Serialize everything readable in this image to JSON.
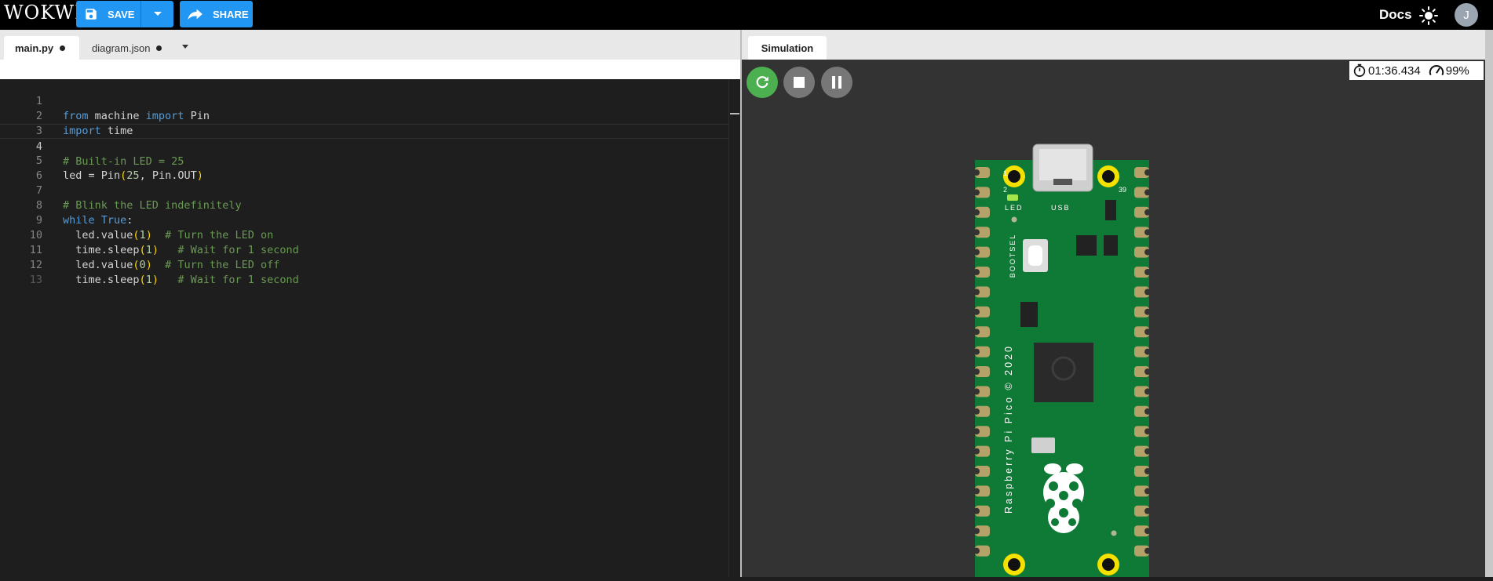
{
  "app": {
    "logo": "WOKWI"
  },
  "header": {
    "save_label": "SAVE",
    "share_label": "SHARE",
    "docs_label": "Docs",
    "avatar_initial": "J"
  },
  "editor": {
    "tabs": [
      {
        "label": "main.py",
        "modified": true
      },
      {
        "label": "diagram.json",
        "modified": true
      }
    ],
    "lines": [
      {
        "n": "1",
        "text": "from machine import Pin"
      },
      {
        "n": "2",
        "text": "import time"
      },
      {
        "n": "3",
        "text": ""
      },
      {
        "n": "4",
        "text": "# Built-in LED = 25"
      },
      {
        "n": "5",
        "text": "led = Pin(25, Pin.OUT)"
      },
      {
        "n": "6",
        "text": ""
      },
      {
        "n": "7",
        "text": "# Blink the LED indefinitely"
      },
      {
        "n": "8",
        "text": "while True:"
      },
      {
        "n": "9",
        "text": "  led.value(1)  # Turn the LED on"
      },
      {
        "n": "10",
        "text": "  time.sleep(1)   # Wait for 1 second"
      },
      {
        "n": "11",
        "text": "  led.value(0)  # Turn the LED off"
      },
      {
        "n": "12",
        "text": "  time.sleep(1)   # Wait for 1 second"
      },
      {
        "n": "13",
        "text": ""
      }
    ]
  },
  "simulation": {
    "tab_label": "Simulation",
    "elapsed": "01:36.434",
    "speed": "99%",
    "board": {
      "pin_labels": {
        "p1": "1",
        "p2": "2",
        "p39": "39"
      },
      "led_label": "LED",
      "usb_label": "USB",
      "bootsel_label": "BOOTSEL",
      "board_text": "Raspberry Pi Pico © 2020"
    }
  },
  "colors": {
    "accent": "#2196f3",
    "run_green": "#4caf50",
    "board_green": "#0e7a35",
    "pad_yellow": "#f5e100"
  }
}
